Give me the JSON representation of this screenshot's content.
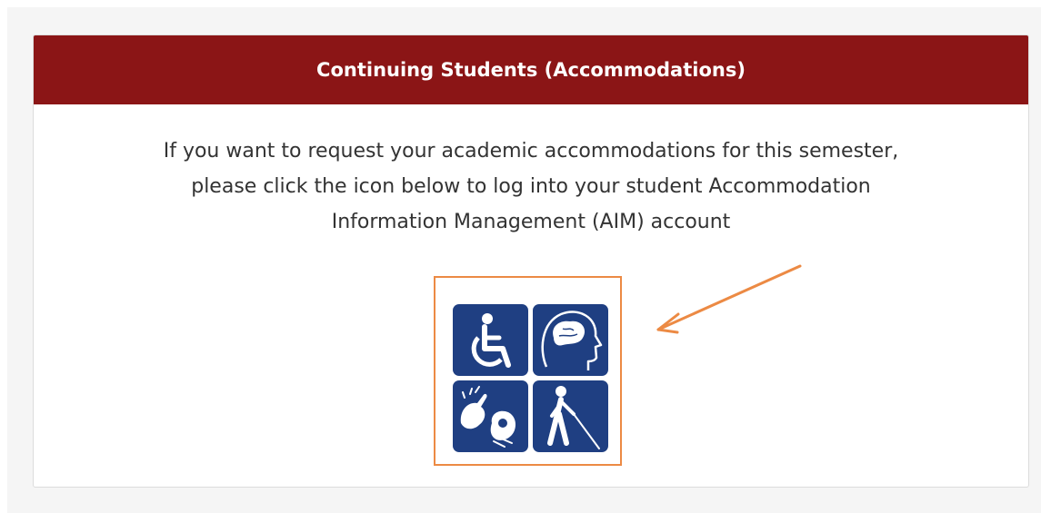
{
  "header": {
    "title": "Continuing Students (Accommodations)"
  },
  "body": {
    "lines": [
      "If you want to request your academic accommodations for this semester,",
      "please click the icon below to log into your student Accommodation",
      "Information Management (AIM) account"
    ]
  },
  "login_icon": {
    "tiles": [
      "wheelchair-icon",
      "head-brain-icon",
      "sign-language-icon",
      "blind-cane-icon"
    ]
  },
  "colors": {
    "header_bg": "#8b1516",
    "tile_bg": "#1f3f82",
    "highlight": "#ec8a44"
  }
}
